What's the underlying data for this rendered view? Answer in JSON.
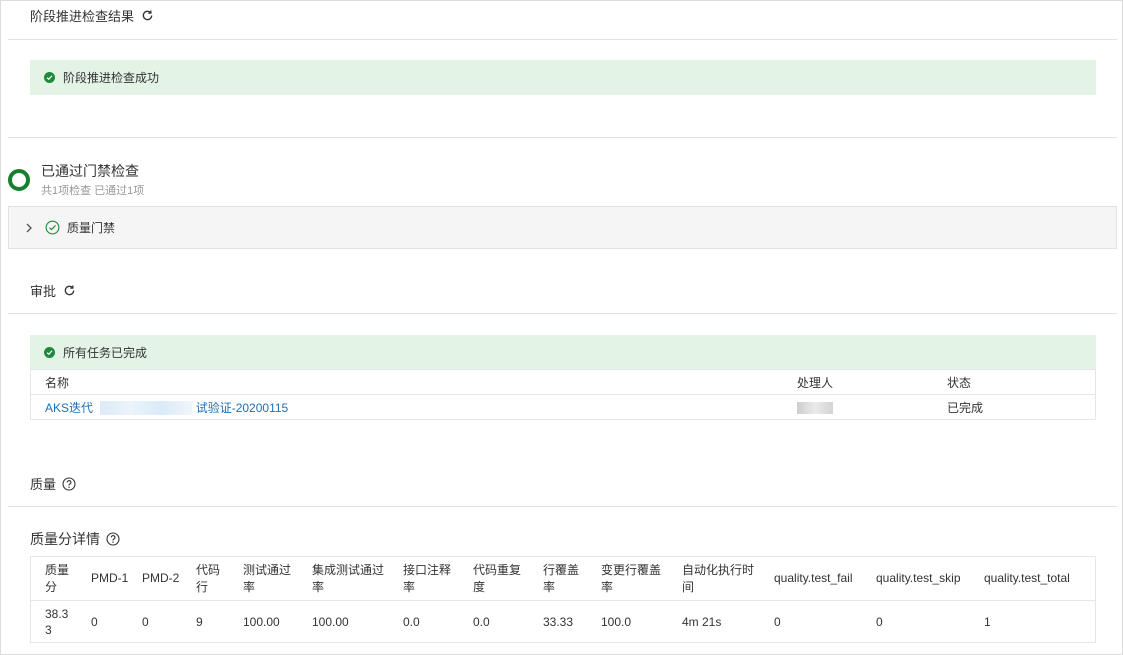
{
  "stage_check": {
    "title": "阶段推进检查结果",
    "banner": "阶段推进检查成功"
  },
  "gate": {
    "title": "已通过门禁检查",
    "summary": "共1项检查 已通过1项",
    "items": [
      {
        "label": "质量门禁"
      }
    ]
  },
  "approval": {
    "title": "审批",
    "banner": "所有任务已完成",
    "columns": {
      "name": "名称",
      "handler": "处理人",
      "status": "状态"
    },
    "rows": [
      {
        "name_prefix": "AKS迭代",
        "name_suffix": "试验证-20200115",
        "status": "已完成"
      }
    ]
  },
  "quality": {
    "title": "质量",
    "detail_title": "质量分详情",
    "columns": [
      "质量分",
      "PMD-1",
      "PMD-2",
      "代码行",
      "测试通过率",
      "集成测试通过率",
      "接口注释率",
      "代码重复度",
      "行覆盖率",
      "变更行覆盖率",
      "自动化执行时间",
      "quality.test_fail",
      "quality.test_skip",
      "quality.test_total"
    ],
    "values": [
      "38.33",
      "0",
      "0",
      "9",
      "100.00",
      "100.00",
      "0.0",
      "0.0",
      "33.33",
      "100.0",
      "4m 21s",
      "0",
      "0",
      "1"
    ]
  },
  "colors": {
    "success": "#1f8a3b",
    "banner_bg": "#e3f3e6",
    "link": "#1e6fb3"
  },
  "icons": [
    "refresh-icon",
    "check-circle-icon",
    "chevron-right-icon",
    "help-icon"
  ]
}
